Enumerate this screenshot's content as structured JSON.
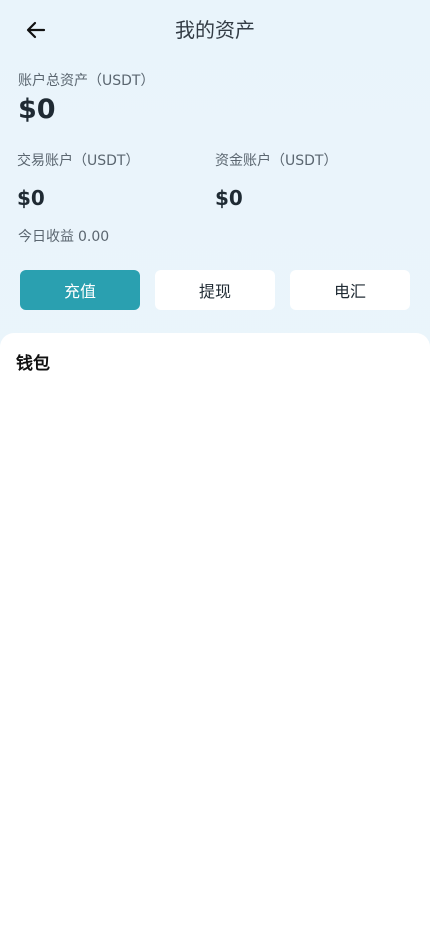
{
  "header": {
    "title": "我的资产",
    "back_icon": "arrow-left-icon"
  },
  "summary": {
    "total_label": "账户总资产（USDT）",
    "total_value": "$0",
    "trade_label": "交易账户（USDT）",
    "trade_value": "$0",
    "fund_label": "资金账户（USDT）",
    "fund_value": "$0",
    "today_label": "今日收益",
    "today_value": "0.00"
  },
  "actions": {
    "deposit": "充值",
    "withdraw": "提现",
    "wire": "电汇"
  },
  "wallet": {
    "title": "钱包"
  },
  "colors": {
    "accent": "#2aa0b0",
    "background": "#eaf4fb"
  }
}
